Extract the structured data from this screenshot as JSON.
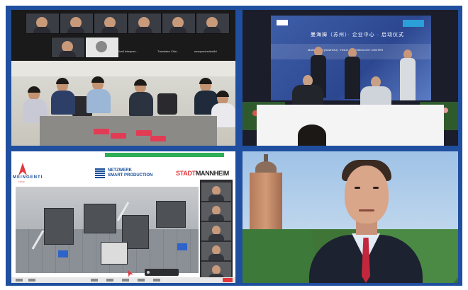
{
  "top_left": {
    "gallery_names": [
      "Sunil Interpret...",
      "Translator Chin...",
      "susoproduction8d"
    ]
  },
  "top_right": {
    "backdrop_title": "曼海姆（苏州）· 企业中心 · 启动仪式",
    "backdrop_subtitle": "MANNHEIM (SUZHOU) · HOLD · TECHNOLOGY CENTER"
  },
  "bottom_left": {
    "logo_main": "MEINGENTI",
    "logo_sub": "FOUR",
    "netzwerk_line1": "NETZWERK",
    "netzwerk_line2": "SMART PRODUCTION",
    "stadt_red": "STADT",
    "stadt_dark": "MANNHEIM"
  }
}
